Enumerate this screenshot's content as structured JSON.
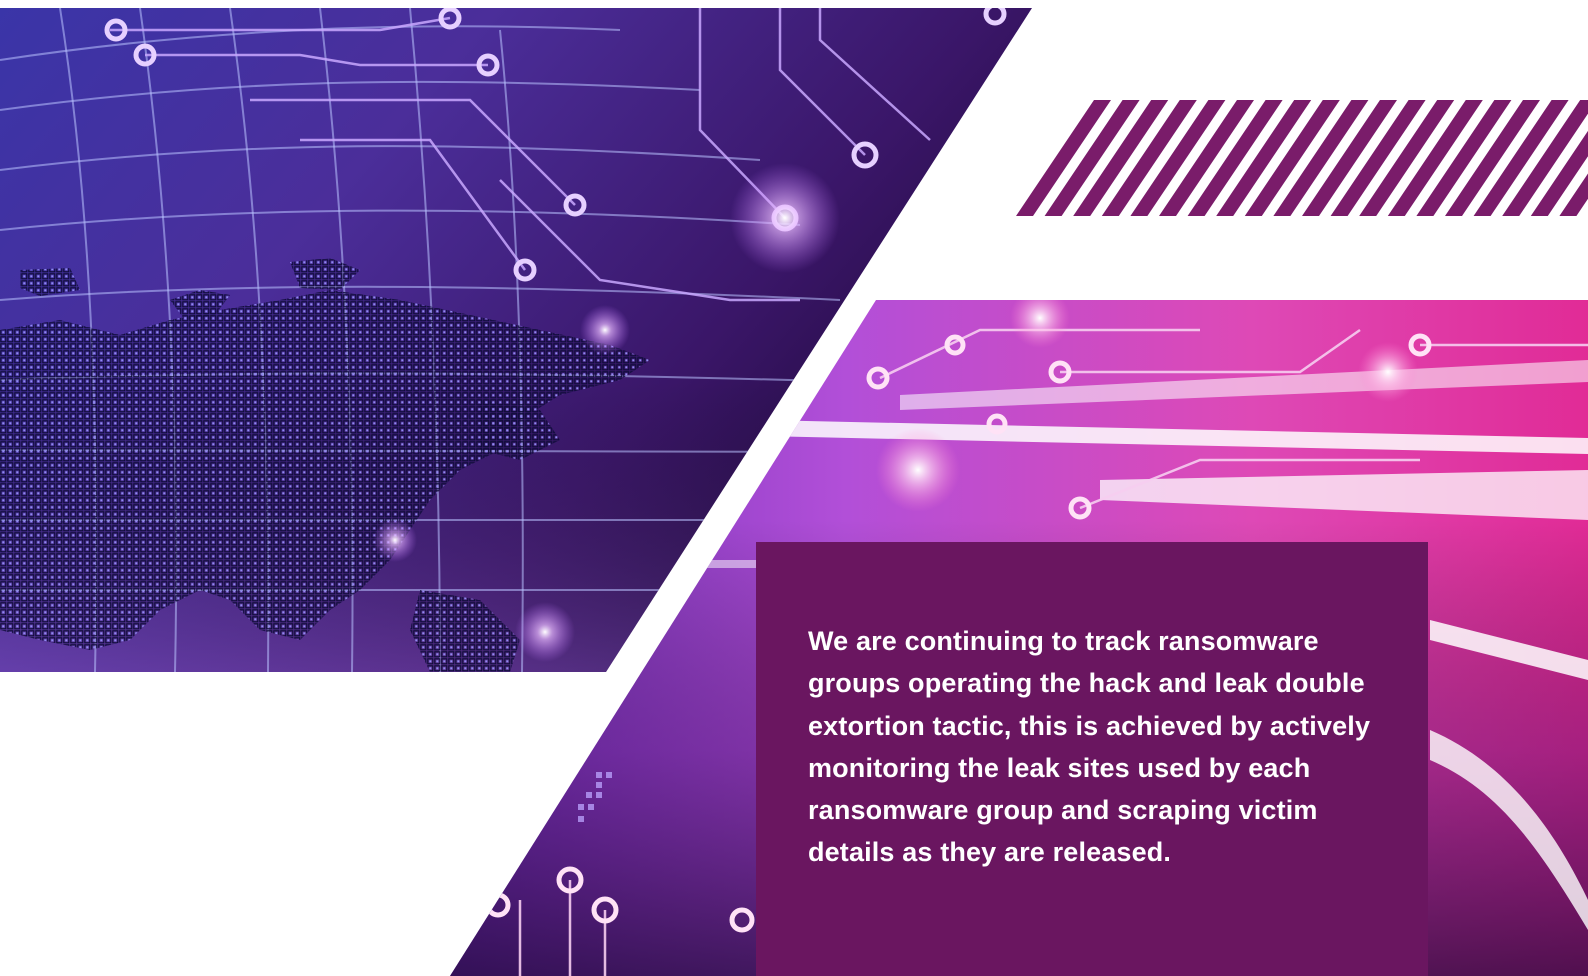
{
  "colors": {
    "accent_purple": "#6a1660",
    "magenta": "#c8158f",
    "deep_violet": "#2a0a4a",
    "glow_blue": "#6a78ff",
    "stripe": "#7a1c6a"
  },
  "icons": [
    "dotted-world-map-icon",
    "circuit-trace-icon",
    "light-glow-icon"
  ],
  "callout": {
    "text": "We are continuing to track ransomware groups operating the hack and leak double extortion tactic, this is achieved by actively monitoring the leak sites used by each ransomware group and scraping victim details as they are released."
  }
}
